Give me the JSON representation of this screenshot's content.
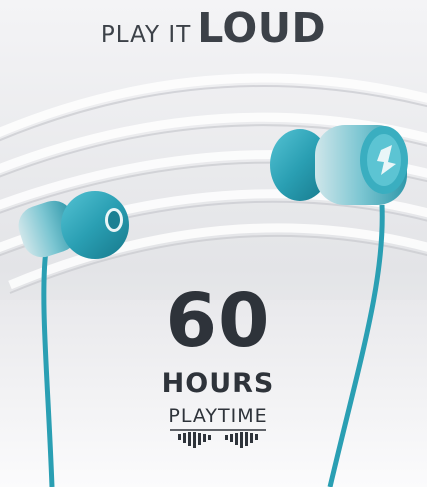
{
  "headline": {
    "prefix": "PLAY IT",
    "emphasis": "LOUD"
  },
  "feature": {
    "number": "60",
    "unit": "HOURS",
    "label": "PLAYTIME"
  },
  "colors": {
    "text": "#2e333a",
    "earbud": "#2a9fb3",
    "earbud_dark": "#1b7f92",
    "background": "#ececee"
  },
  "icons": [
    "sound-wave-icon",
    "brand-logo-icon"
  ]
}
